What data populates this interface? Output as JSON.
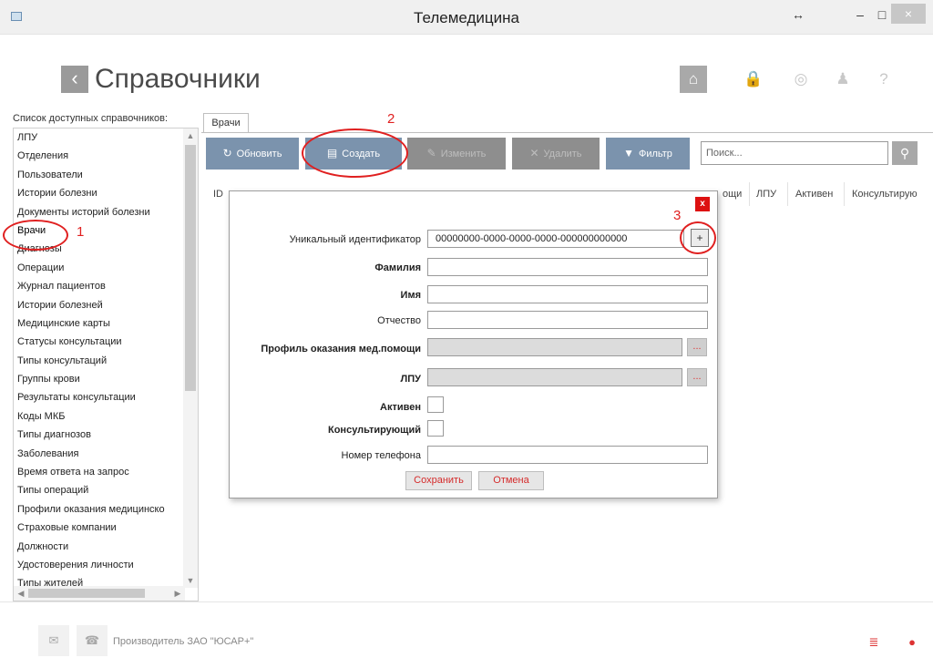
{
  "window": {
    "title": "Телемедицина",
    "restore": "↔",
    "minimize": "–",
    "maximize": "□",
    "close": "×"
  },
  "header": {
    "back": "‹",
    "title": "Справочники",
    "home_icon": "⌂",
    "lock_icon": "🔒",
    "settings_icon": "◎",
    "user_icon": "♟",
    "help_icon": "?"
  },
  "sidebar": {
    "caption": "Список доступных справочников:",
    "items": [
      "ЛПУ",
      "Отделения",
      "Пользователи",
      "Истории болезни",
      "Документы историй болезни",
      "Врачи",
      "Диагнозы",
      "Операции",
      "Журнал пациентов",
      "Истории болезней",
      "Медицинские карты",
      "Статусы консультации",
      "Типы консультаций",
      "Группы крови",
      "Результаты консультации",
      "Коды МКБ",
      "Типы диагнозов",
      "Заболевания",
      "Время ответа на запрос",
      "Типы операций",
      "Профили оказания медицинско",
      "Страховые компании",
      "Должности",
      "Удостоверения личности",
      "Типы жителей"
    ],
    "selected": "Врачи"
  },
  "tab": {
    "label": "Врачи"
  },
  "toolbar": {
    "refresh": "Обновить",
    "refresh_icon": "↻",
    "create": "Создать",
    "create_icon": "▤",
    "edit": "Изменить",
    "edit_icon": "✎",
    "delete": "Удалить",
    "delete_icon": "✕",
    "filter": "Фильтр",
    "filter_icon": "▼",
    "search_placeholder": "Поиск...",
    "search_icon": "⚲"
  },
  "grid": {
    "columns": [
      "ID",
      "ощи",
      "ЛПУ",
      "Активен",
      "Консультирую"
    ]
  },
  "dialog": {
    "close": "x",
    "uid_label": "Уникальный идентификатор",
    "uid_value": "00000000-0000-0000-0000-000000000000",
    "uid_button": "+",
    "surname_label": "Фамилия",
    "name_label": "Имя",
    "patronymic_label": "Отчество",
    "profile_label": "Профиль оказания мед.помощи",
    "lpu_label": "ЛПУ",
    "dots": "...",
    "active_label": "Активен",
    "consulting_label": "Консультирующий",
    "phone_label": "Номер телефона",
    "save": "Сохранить",
    "cancel": "Отмена"
  },
  "annotations": {
    "n1": "1",
    "n2": "2",
    "n3": "3"
  },
  "footer": {
    "mail_icon": "✉",
    "phone_icon": "☎",
    "producer": "Производитель ЗАО \"ЮСАР+\"",
    "db_icon": "≣",
    "globe_icon": "●"
  },
  "colors": {
    "accent": "#7b93ad",
    "annotation": "#e02020",
    "disabled": "#8e8e8e"
  }
}
